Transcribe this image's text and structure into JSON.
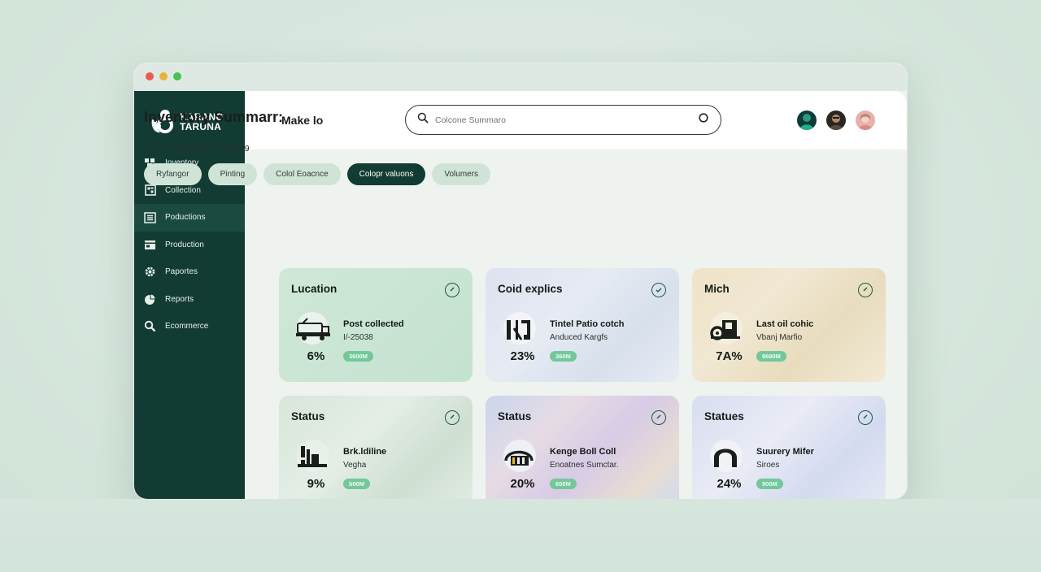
{
  "brand": {
    "line1": "KARANG",
    "line2": "TARUNA"
  },
  "sidebar": {
    "items": [
      {
        "label": "Inventory",
        "icon": "boxes-icon"
      },
      {
        "label": "Collection",
        "icon": "grid-icon"
      },
      {
        "label": "Poductions",
        "icon": "list-icon",
        "active": true
      },
      {
        "label": "Production",
        "icon": "film-icon"
      },
      {
        "label": "Paportes",
        "icon": "gear-icon"
      },
      {
        "label": "Reports",
        "icon": "pie-icon"
      },
      {
        "label": "Ecommerce",
        "icon": "search-icon"
      }
    ]
  },
  "header": {
    "title": "Make lo",
    "search_placeholder": "Colcone Summaro"
  },
  "main": {
    "heading": "Inventory Summarr:",
    "subtext": "The ar mora erko uo:k 9289",
    "chips": [
      {
        "label": "Ryfangor",
        "active": false
      },
      {
        "label": "Pinting",
        "active": false
      },
      {
        "label": "Colol Eoacnce",
        "active": false
      },
      {
        "label": "Colopr valuons",
        "active": true
      },
      {
        "label": "Volumers",
        "active": false
      }
    ]
  },
  "cards": [
    {
      "title": "Lucation",
      "label": "Post collected",
      "sub": "I/-25038",
      "percent": "6%",
      "badge": "3600M",
      "icon": "truck-icon"
    },
    {
      "title": "Coid explics",
      "label": "Tintel Patio cotch",
      "sub": "Anduced Kargfs",
      "percent": "23%",
      "badge": "360M",
      "icon": "bracket-icon"
    },
    {
      "title": "Mich",
      "label": "Last oil cohic",
      "sub": "Vbanj Marfio",
      "percent": "7A%",
      "badge": "9680M",
      "icon": "tractor-icon"
    },
    {
      "title": "Status",
      "label": "Brk.ldiline",
      "sub": "Vegha",
      "percent": "9%",
      "badge": "b00M",
      "icon": "factory-icon"
    },
    {
      "title": "Status",
      "label": "Kenge Boll Coll",
      "sub": "Enoatnes Sumctar.",
      "percent": "20%",
      "badge": "600M",
      "icon": "warehouse-icon"
    },
    {
      "title": "Statues",
      "label": "Suurery Mifer",
      "sub": "Siroes",
      "percent": "24%",
      "badge": "900M",
      "icon": "arch-icon"
    }
  ],
  "colors": {
    "sidebar": "#123c33",
    "accent": "#123c33",
    "chip": "#cfe4d7",
    "badge": "#74c79a"
  }
}
